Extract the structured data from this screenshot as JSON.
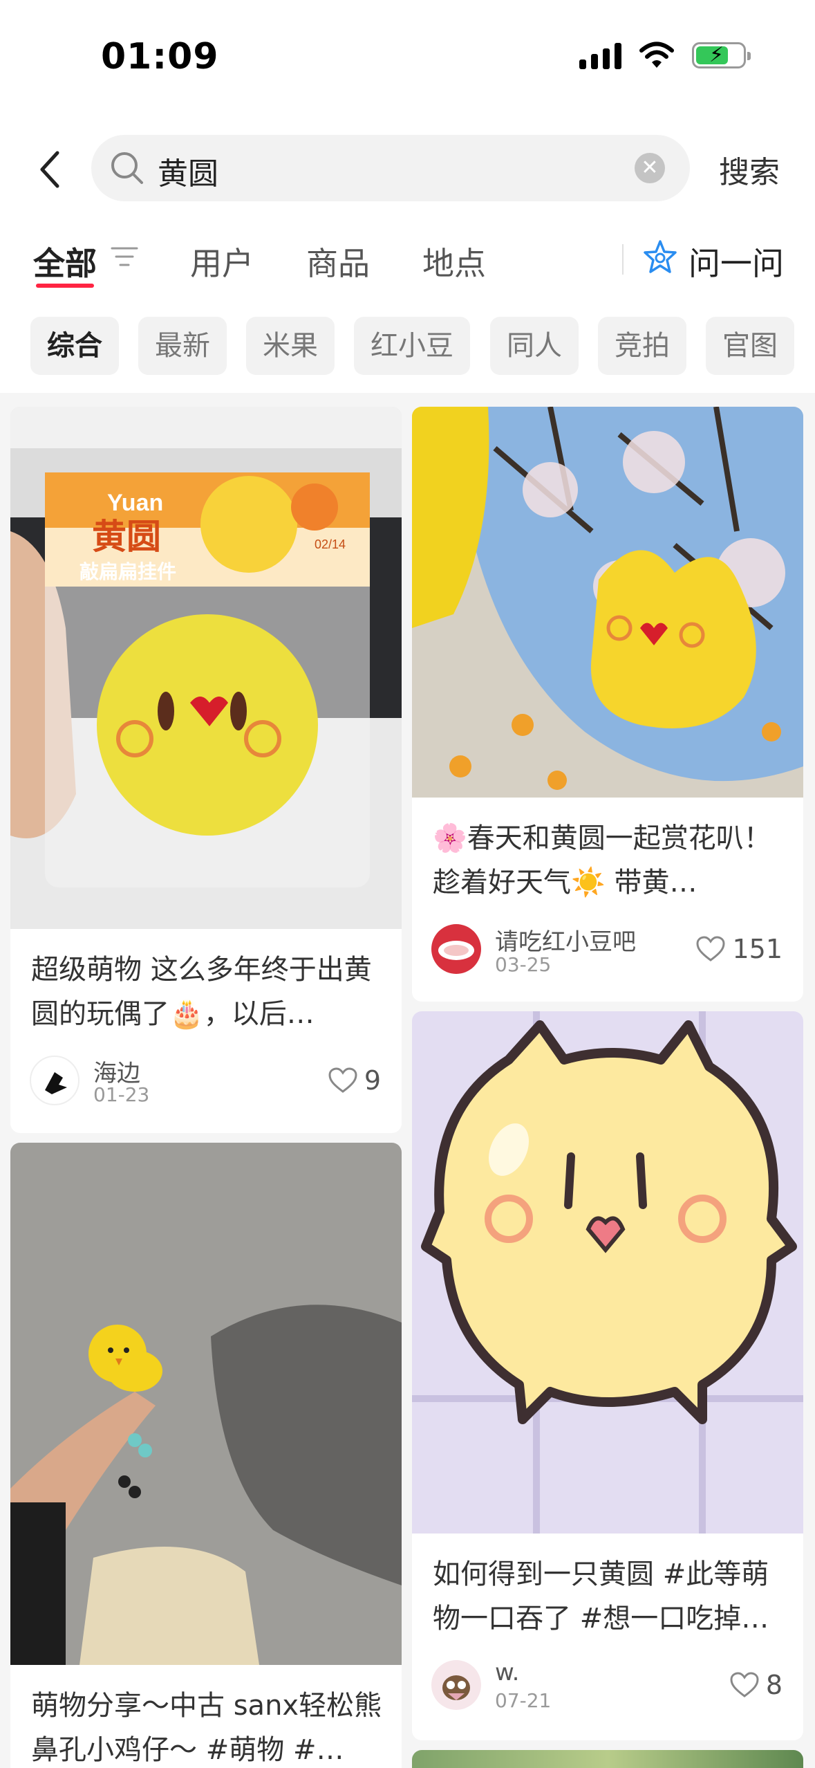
{
  "status_bar": {
    "time": "01:09"
  },
  "search": {
    "query": "黄圆",
    "submit_label": "搜索"
  },
  "tabs": [
    {
      "label": "全部"
    },
    {
      "label": "用户"
    },
    {
      "label": "商品"
    },
    {
      "label": "地点"
    }
  ],
  "ask": {
    "label": "问一问"
  },
  "chips": [
    "综合",
    "最新",
    "米果",
    "红小豆",
    "同人",
    "竞拍",
    "官图"
  ],
  "colors": {
    "accent": "#ff2442",
    "chip_bg": "#f2f2f2",
    "page_bg": "#f5f5f5"
  },
  "cards": [
    {
      "title": "超级萌物 这么多年终于出黄圆的玩偶了🎂，以后…",
      "author": "海边",
      "date": "01-23",
      "likes": "9",
      "image": {
        "package_brand": "Yuan",
        "package_title": "黄圆",
        "package_subtitle": "敲扁扁挂件",
        "package_date": "02/14"
      }
    },
    {
      "title": "🌸春天和黄圆一起赏花叭！ 趁着好天气☀️ 带黄…",
      "author": "请吃红小豆吧",
      "date": "03-25",
      "likes": "151"
    },
    {
      "title": "萌物分享～中古 sanx轻松熊鼻孔小鸡仔～ #萌物 #…",
      "author": "",
      "date": "",
      "likes": ""
    },
    {
      "title": "如何得到一只黄圆 #此等萌物一口吞了 #想一口吃掉…",
      "author": "w.",
      "date": "07-21",
      "likes": "8"
    }
  ]
}
